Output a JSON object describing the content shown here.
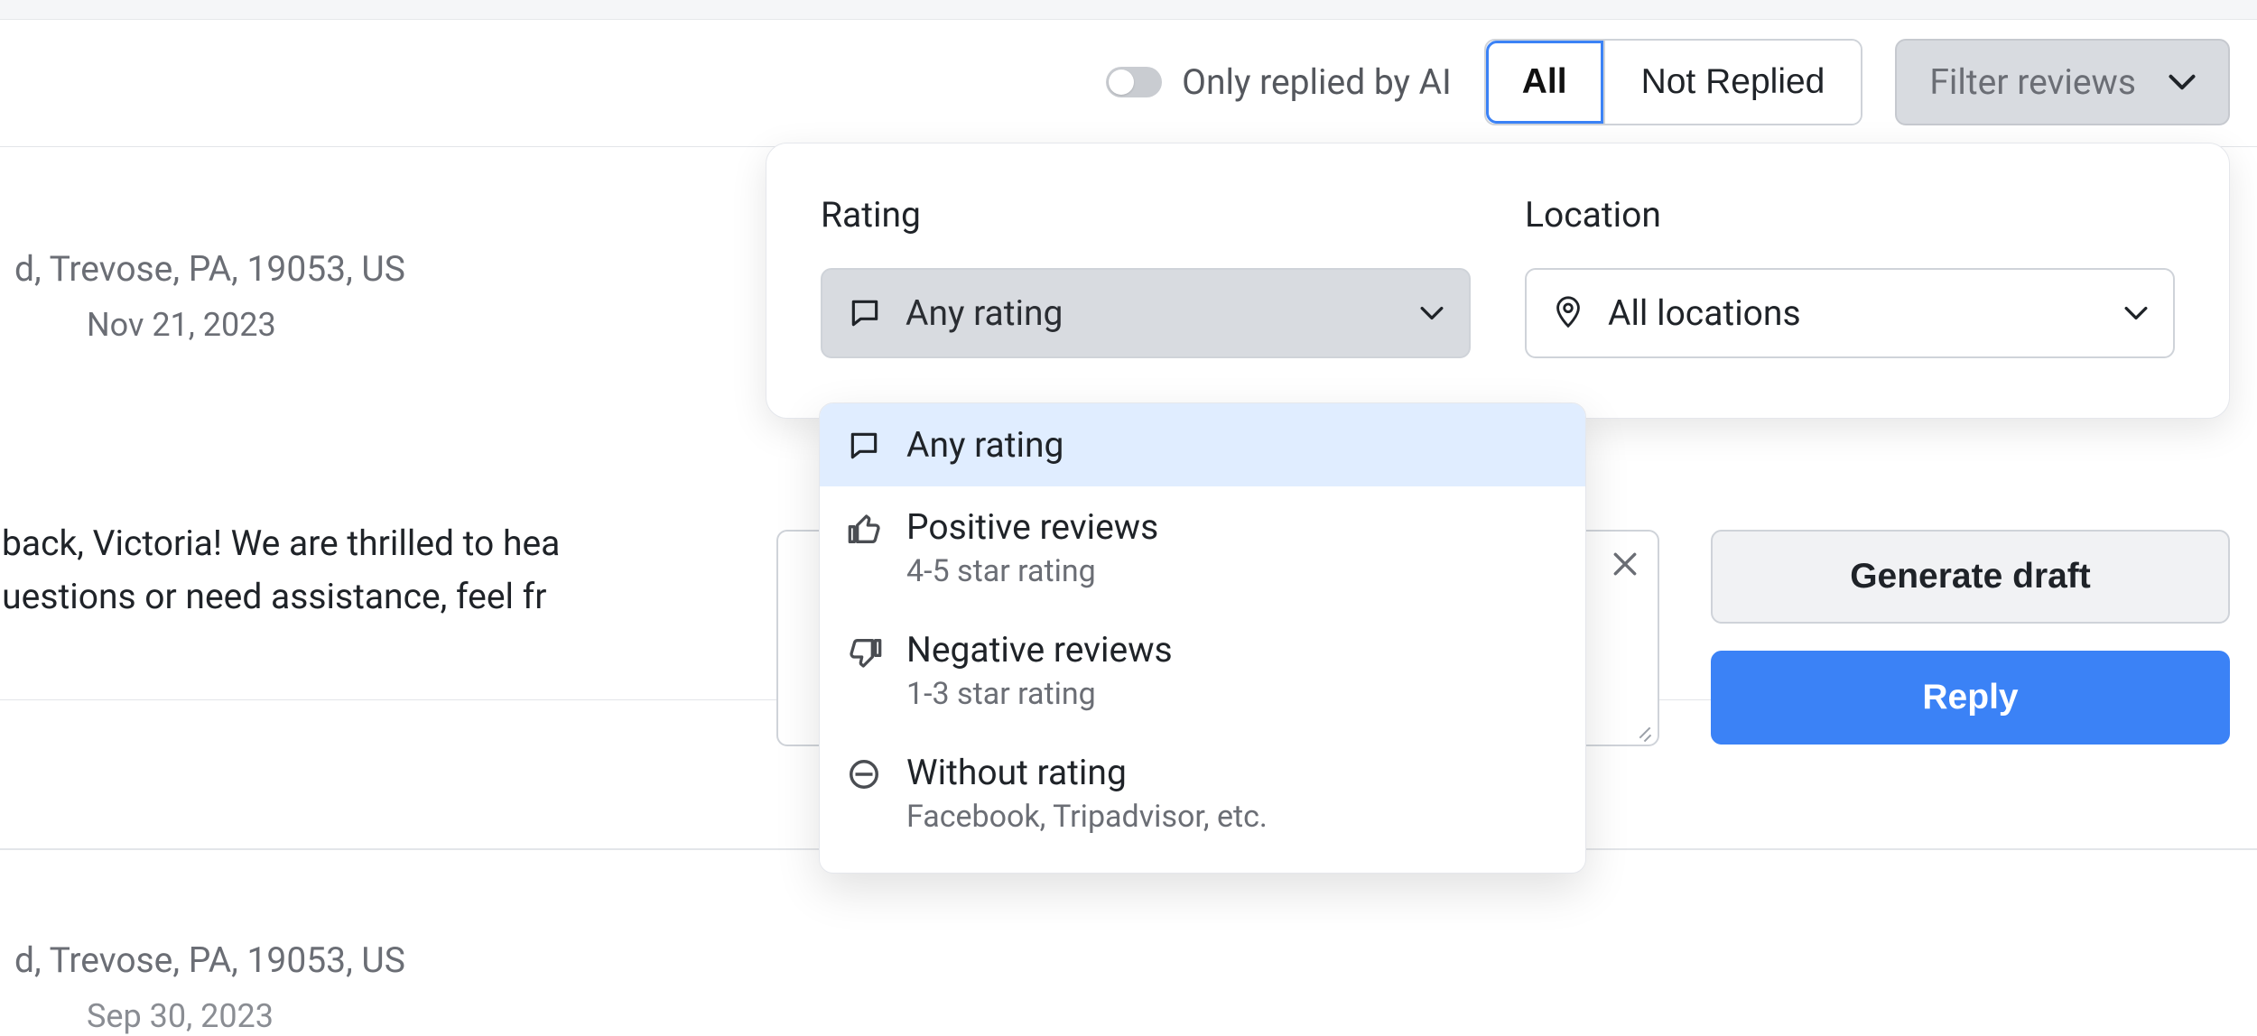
{
  "toolbar": {
    "ai_toggle_label": "Only replied by AI",
    "tabs": {
      "all": "All",
      "not_replied": "Not Replied",
      "active": "all"
    },
    "filter_button": "Filter reviews"
  },
  "filter_popover": {
    "rating_label": "Rating",
    "location_label": "Location",
    "rating_selected": "Any rating",
    "location_selected": "All locations",
    "rating_options": [
      {
        "key": "any",
        "title": "Any rating",
        "subtitle": "",
        "icon": "chat-icon"
      },
      {
        "key": "positive",
        "title": "Positive reviews",
        "subtitle": "4-5 star rating",
        "icon": "thumbs-up-icon"
      },
      {
        "key": "negative",
        "title": "Negative reviews",
        "subtitle": "1-3 star rating",
        "icon": "thumbs-down-icon"
      },
      {
        "key": "none",
        "title": "Without rating",
        "subtitle": "Facebook, Tripadvisor, etc.",
        "icon": "no-entry-icon"
      }
    ]
  },
  "reviews": {
    "card1": {
      "address_fragment": "d, Trevose, PA, 19053, US",
      "date": "Nov 21, 2023",
      "reply_line1": "dback, Victoria! We are thrilled to hea",
      "reply_line2": "questions or need assistance, feel fr"
    },
    "card2": {
      "address_fragment": "d, Trevose, PA, 19053, US",
      "date": "Sep 30, 2023"
    }
  },
  "actions": {
    "generate_draft": "Generate draft",
    "reply": "Reply"
  }
}
